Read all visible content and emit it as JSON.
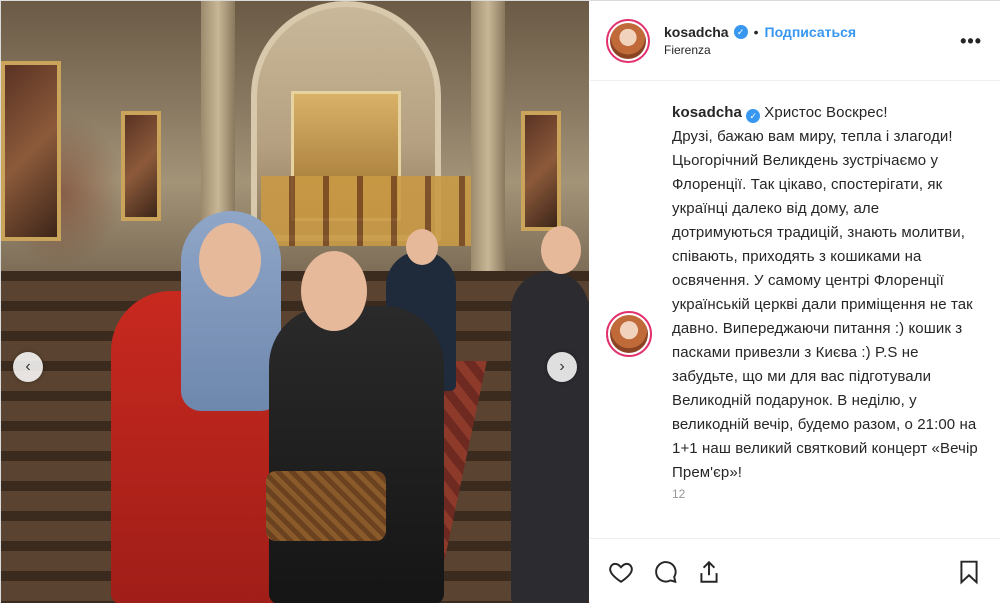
{
  "post": {
    "username": "kosadcha",
    "follow_label": "Подписаться",
    "location": "Fierenza",
    "more_label": "•••",
    "separator": "•",
    "caption_username": "kosadcha",
    "caption": "Христос Воскрес!\nДрузі, бажаю вам миру, тепла і злагоди!\nЦьогорічний Великдень зустрічаємо у Флоренції. Так цікаво, спостерігати, як українці далеко від дому, але дотримуються традицій, знають молитви, співають, приходять з кошиками на освячення. У самому центрі Флоренції українській церкві дали приміщення не так давно. Випереджаючи питання :) кошик з пасками привезли з Києва :) P.S не забудьте, що ми для вас підготували Великодній подарунок. В неділю, у великодній вечір, будемо разом, о 21:00 на 1+1 наш великий святковий концерт «Вечір Прем'єр»!",
    "timestamp_fragment": "12"
  },
  "icons": {
    "verified": "verified-check-icon",
    "like": "heart-icon",
    "comment": "comment-bubble-icon",
    "share": "share-arrow-icon",
    "save": "bookmark-icon",
    "prev": "chevron-left-icon",
    "next": "chevron-right-icon"
  },
  "colors": {
    "accent": "#3897f0",
    "ring": "#e1306c"
  }
}
